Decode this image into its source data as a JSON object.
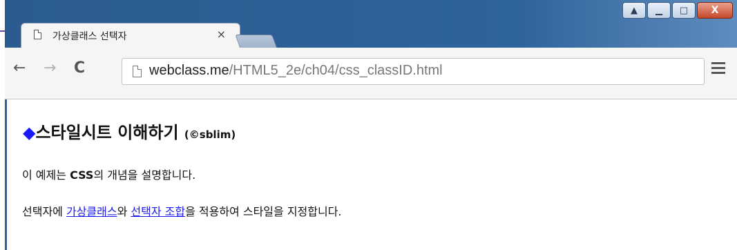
{
  "window": {
    "tab_title": "가상클래스 선택자",
    "tab_close": "×",
    "caption_user": "▲",
    "caption_min": "▁",
    "caption_max": "□",
    "caption_close": "X"
  },
  "toolbar": {
    "back": "←",
    "forward": "→",
    "reload": "C",
    "url_host": "webclass.me",
    "url_path": "/HTML5_2e/ch04/css_classID.html"
  },
  "page": {
    "heading_marker": "◆",
    "heading_text": "스타일시트 이해하기",
    "heading_credit": "(©sblim)",
    "p1_pre": "이 예제는 ",
    "p1_bold": "CSS",
    "p1_post": "의 개념을 설명합니다.",
    "p2_pre": "선택자에 ",
    "p2_link1": "가상클래스",
    "p2_mid": "와 ",
    "p2_link2": "선택자 조합",
    "p2_post": "을 적용하여 스타일을 지정합니다."
  },
  "colors": {
    "titlebar": "#2f639b",
    "link": "#1a1aee",
    "diamond": "#1a1aff"
  }
}
